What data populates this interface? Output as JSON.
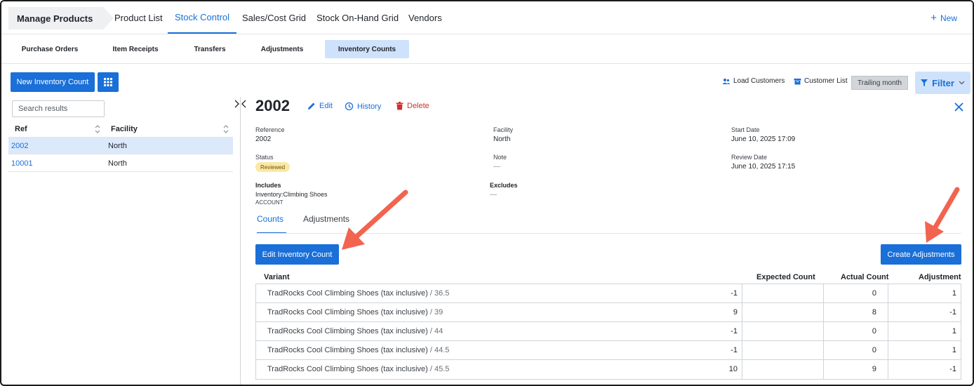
{
  "nav": {
    "brand": "Manage Products",
    "tabs": [
      "Product List",
      "Stock Control",
      "Sales/Cost Grid",
      "Stock On-Hand Grid",
      "Vendors"
    ],
    "active_tab": "Stock Control",
    "new_label": "New"
  },
  "subnav": {
    "tabs": [
      "Purchase Orders",
      "Item Receipts",
      "Transfers",
      "Adjustments",
      "Inventory Counts"
    ],
    "active_tab": "Inventory Counts"
  },
  "toolbar": {
    "new_count_label": "New Inventory Count",
    "load_customers_label": "Load Customers",
    "customer_list_label": "Customer List",
    "trailing_label": "Trailing month",
    "filter_label": "Filter"
  },
  "list": {
    "search_placeholder": "Search results",
    "columns": [
      "Ref",
      "Facility"
    ],
    "rows": [
      {
        "ref": "2002",
        "facility": "North"
      },
      {
        "ref": "10001",
        "facility": "North"
      }
    ]
  },
  "detail": {
    "title": "2002",
    "edit_label": "Edit",
    "history_label": "History",
    "delete_label": "Delete",
    "reference_label": "Reference",
    "reference_value": "2002",
    "facility_label": "Facility",
    "facility_value": "North",
    "start_date_label": "Start Date",
    "start_date_value": "June 10, 2025 17:09",
    "status_label": "Status",
    "status_value": "Reviewed",
    "note_label": "Note",
    "note_value": "—",
    "review_date_label": "Review Date",
    "review_date_value": "June 10, 2025 17:15",
    "includes_label": "Includes",
    "includes_value": "Inventory:Climbing Shoes",
    "includes_type": "ACCOUNT",
    "excludes_label": "Excludes",
    "excludes_value": "—",
    "tabs": [
      "Counts",
      "Adjustments"
    ],
    "active_tab": "Counts",
    "edit_count_label": "Edit Inventory Count",
    "create_adjustments_label": "Create Adjustments"
  },
  "table": {
    "columns": [
      "Variant",
      "Expected Count",
      "Actual Count",
      "Adjustment"
    ],
    "rows": [
      {
        "product": "TradRocks Cool Climbing Shoes (tax inclusive)",
        "option": "/ 36.5",
        "expected": "-1",
        "actual": "0",
        "adjustment": "1"
      },
      {
        "product": "TradRocks Cool Climbing Shoes (tax inclusive)",
        "option": "/ 39",
        "expected": "9",
        "actual": "8",
        "adjustment": "-1"
      },
      {
        "product": "TradRocks Cool Climbing Shoes (tax inclusive)",
        "option": "/ 44",
        "expected": "-1",
        "actual": "0",
        "adjustment": "1"
      },
      {
        "product": "TradRocks Cool Climbing Shoes (tax inclusive)",
        "option": "/ 44.5",
        "expected": "-1",
        "actual": "0",
        "adjustment": "1"
      },
      {
        "product": "TradRocks Cool Climbing Shoes (tax inclusive)",
        "option": "/ 45.5",
        "expected": "10",
        "actual": "9",
        "adjustment": "-1"
      }
    ]
  },
  "colors": {
    "accent": "#1a6fd8",
    "delete": "#d0312d",
    "arrow": "#f2644f",
    "badge_bg": "#fbe8a6"
  }
}
